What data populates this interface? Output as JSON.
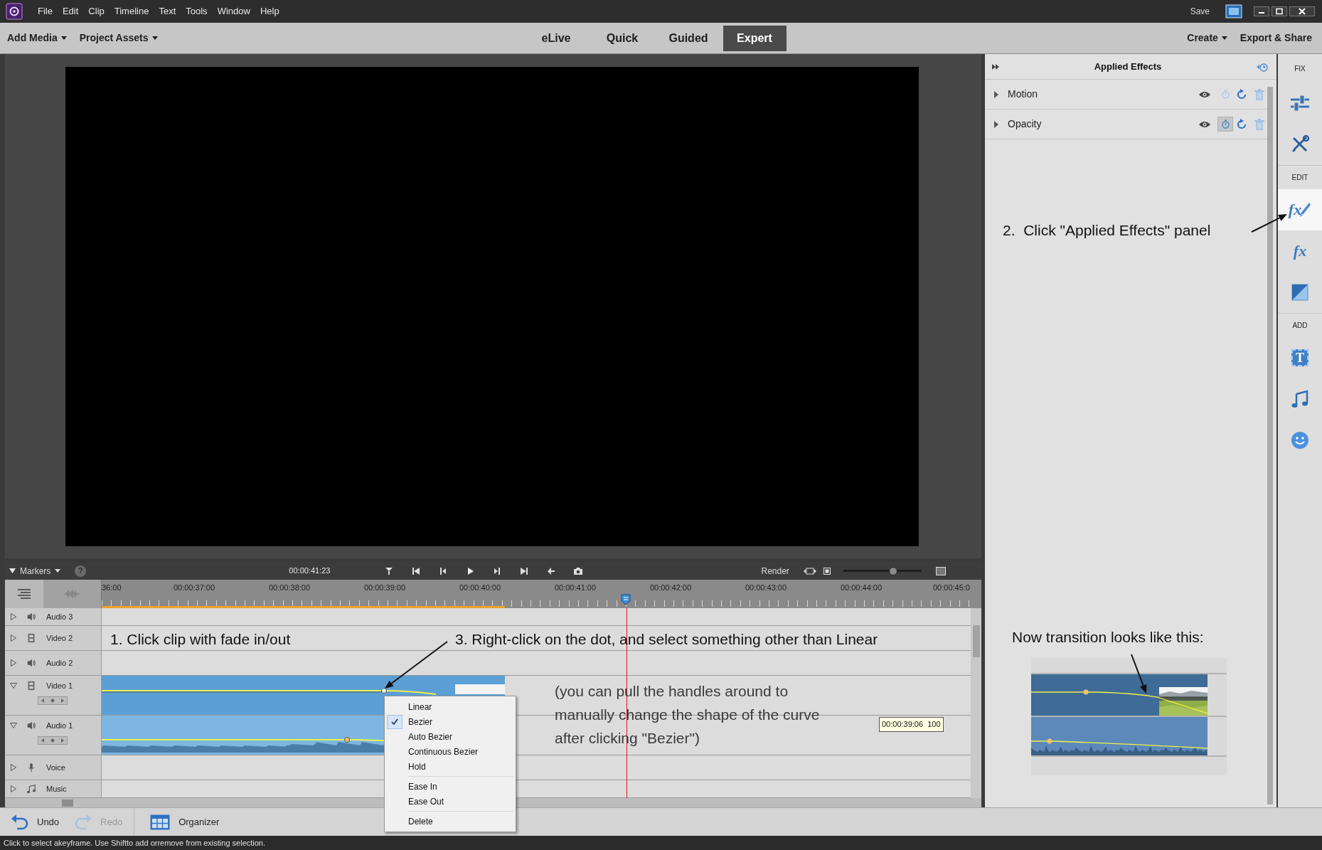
{
  "menu_bar": {
    "items": [
      "File",
      "Edit",
      "Clip",
      "Timeline",
      "Text",
      "Tools",
      "Window",
      "Help"
    ],
    "save": "Save"
  },
  "mode_bar": {
    "left": [
      {
        "label": "Add Media",
        "dropdown": true
      },
      {
        "label": "Project Assets",
        "dropdown": true
      }
    ],
    "tabs": [
      {
        "label": "eLive",
        "selected": false
      },
      {
        "label": "Quick",
        "selected": false
      },
      {
        "label": "Guided",
        "selected": false
      },
      {
        "label": "Expert",
        "selected": true
      }
    ],
    "right": [
      {
        "label": "Create",
        "dropdown": true
      },
      {
        "label": "Export & Share",
        "dropdown": false
      }
    ]
  },
  "timeline": {
    "markers": "Markers",
    "help": "?",
    "timecode": "00:00:41:23",
    "render": "Render",
    "zoom": {
      "level": 0.64
    },
    "ruler": [
      "36:00",
      "00:00:37:00",
      "00:00:38:00",
      "00:00:39:00",
      "00:00:40:00",
      "00:00:41:00",
      "00:00:42:00",
      "00:00:43:00",
      "00:00:44:00",
      "00:00:45:0"
    ],
    "tracks": [
      {
        "name": "Audio 3",
        "kind": "audio",
        "expanded": false,
        "has_clip": false
      },
      {
        "name": "Video 2",
        "kind": "video",
        "expanded": false,
        "has_clip": false
      },
      {
        "name": "Audio 2",
        "kind": "audio",
        "expanded": false,
        "has_clip": false
      },
      {
        "name": "Video 1",
        "kind": "video",
        "expanded": true,
        "has_clip": true
      },
      {
        "name": "Audio 1",
        "kind": "audio",
        "expanded": true,
        "has_clip": true
      },
      {
        "name": "Voice",
        "kind": "voice",
        "expanded": false,
        "has_clip": false
      },
      {
        "name": "Music",
        "kind": "music",
        "expanded": false,
        "has_clip": false
      }
    ]
  },
  "annotations": [
    "1. Click clip with fade in/out",
    "3. Right-click on the dot, and select something other than Linear",
    "(you can pull the handles around to\nmanually change the shape of the curve\nafter clicking \"Bezier\")"
  ],
  "tooltip": "00:00:39:06  100",
  "context_menu": {
    "groups": [
      [
        {
          "label": "Linear",
          "checked": false
        },
        {
          "label": "Bezier",
          "checked": true
        },
        {
          "label": "Auto Bezier",
          "checked": false
        },
        {
          "label": "Continuous Bezier",
          "checked": false
        },
        {
          "label": "Hold",
          "checked": false
        }
      ],
      [
        {
          "label": "Ease In",
          "checked": false
        },
        {
          "label": "Ease Out",
          "checked": false
        }
      ],
      [
        {
          "label": "Delete",
          "checked": false
        }
      ]
    ]
  },
  "effects_panel": {
    "title": "Applied Effects",
    "effects": [
      {
        "name": "Motion",
        "animated": false
      },
      {
        "name": "Opacity",
        "animated": true
      }
    ],
    "note": "2.  Click \"Applied Effects\" panel",
    "result_note": "Now transition looks like this:"
  },
  "tool_panel": {
    "sections": [
      {
        "label": "FIX",
        "tools": [
          {
            "kind": "adjust",
            "selected": false
          },
          {
            "kind": "tools",
            "selected": false
          }
        ]
      },
      {
        "label": "EDIT",
        "tools": [
          {
            "kind": "applied_effects",
            "glyph": "fx",
            "selected": true
          },
          {
            "kind": "effects",
            "glyph": "fx",
            "selected": false
          },
          {
            "kind": "transitions",
            "selected": false
          }
        ]
      },
      {
        "label": "ADD",
        "tools": [
          {
            "kind": "titles",
            "glyph": "T",
            "selected": false
          },
          {
            "kind": "music",
            "selected": false
          },
          {
            "kind": "graphics",
            "selected": false
          }
        ]
      }
    ]
  },
  "bottom_bar": {
    "buttons": [
      {
        "kind": "undo",
        "label": "Undo",
        "disabled": false
      },
      {
        "kind": "redo",
        "label": "Redo",
        "disabled": true
      },
      {
        "kind": "organizer",
        "label": "Organizer",
        "disabled": false
      }
    ]
  },
  "status_bar": "Click to select akeyframe. Use Shiftto add orremove from existing selection."
}
